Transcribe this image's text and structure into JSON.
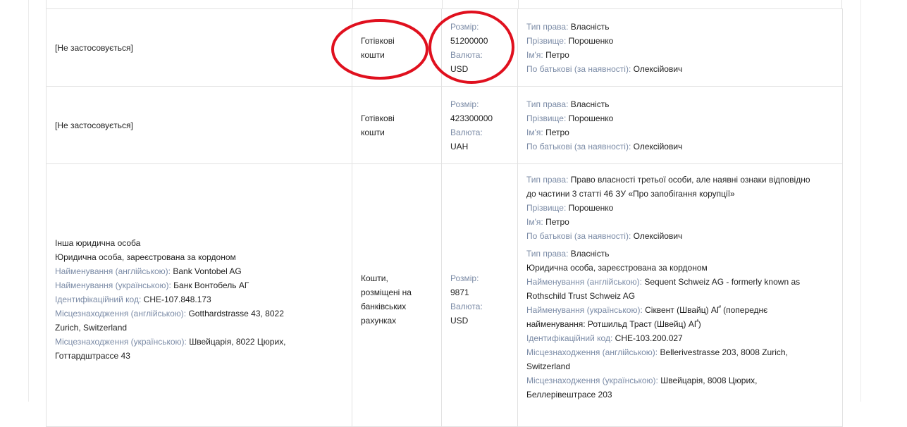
{
  "rows": [
    {
      "object": "[Не застосовується]",
      "type_lines": [
        "Готівкові",
        "кошти"
      ],
      "amount_label": "Розмір:",
      "amount": "51200000",
      "currency_label": "Валюта:",
      "currency": "USD",
      "owner": [
        {
          "label": "Тип права:",
          "value": "Власність"
        },
        {
          "label": "Прізвище:",
          "value": "Порошенко"
        },
        {
          "label": "Ім'я:",
          "value": "Петро"
        },
        {
          "label": "По батькові (за наявності):",
          "value": "Олексійович"
        }
      ]
    },
    {
      "object": "[Не застосовується]",
      "type_lines": [
        "Готівкові",
        "кошти"
      ],
      "amount_label": "Розмір:",
      "amount": "423300000",
      "currency_label": "Валюта:",
      "currency": "UAH",
      "owner": [
        {
          "label": "Тип права:",
          "value": "Власність"
        },
        {
          "label": "Прізвище:",
          "value": "Порошенко"
        },
        {
          "label": "Ім'я:",
          "value": "Петро"
        },
        {
          "label": "По батькові (за наявності):",
          "value": "Олексійович"
        }
      ]
    }
  ],
  "row3": {
    "object_plain": [
      "Інша юридична особа",
      "Юридична особа, зареєстрована за кордоном"
    ],
    "object_fields": [
      {
        "label": "Найменування (англійською):",
        "value": "Bank Vontobel AG"
      },
      {
        "label": "Найменування (українською):",
        "value": "Банк Вонтобель АГ"
      },
      {
        "label": "Ідентифікаційний код:",
        "value": "CHE-107.848.173"
      },
      {
        "label": "Місцезнаходження (англійською):",
        "value": "Gotthardstrasse 43, 8022 Zurich, Switzerland"
      },
      {
        "label": "Місцезнаходження (українською):",
        "value": "Швейцарія, 8022 Цюрих, Готтардштрассе 43"
      }
    ],
    "type_lines": [
      "Кошти,",
      "розміщені на",
      "банківських",
      "рахунках"
    ],
    "amount_label": "Розмір:",
    "amount": "9871",
    "currency_label": "Валюта:",
    "currency": "USD",
    "owner1": [
      {
        "label": "Тип права:",
        "value": "Право власності третьої особи, але наявні ознаки відповідно до частини 3 статті 46 ЗУ «Про запобігання корупції»"
      },
      {
        "label": "Прізвище:",
        "value": "Порошенко"
      },
      {
        "label": "Ім'я:",
        "value": "Петро"
      },
      {
        "label": "По батькові (за наявності):",
        "value": "Олексійович"
      }
    ],
    "owner2_type": {
      "label": "Тип права:",
      "value": "Власність"
    },
    "owner2_plain": "Юридична особа, зареєстрована за кордоном",
    "owner2": [
      {
        "label": "Найменування (англійською):",
        "value": "Sequent Schweiz AG - formerly known as Rothschild Trust Schweiz AG"
      },
      {
        "label": "Найменування (українською):",
        "value": "Сіквент (Швайц) АҐ (попереднє найменування: Ротшильд Траст (Швейц) АҐ)"
      },
      {
        "label": "Ідентифікаційний код:",
        "value": "CHE-103.200.027"
      },
      {
        "label": "Місцезнаходження (англійською):",
        "value": "Bellerivestrasse 203, 8008 Zurich, Switzerland"
      },
      {
        "label": "Місцезнаходження (українською):",
        "value": "Швейцарія, 8008 Цюрих, Беллерівештрасе 203"
      }
    ]
  },
  "annotation_color": "#e0101e"
}
